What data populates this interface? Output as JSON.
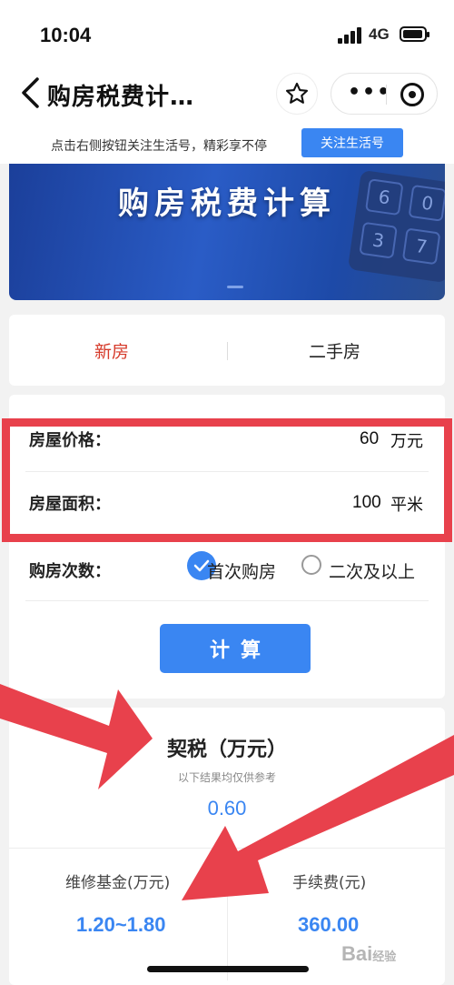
{
  "status": {
    "time": "10:04",
    "network": "4G"
  },
  "nav": {
    "title": "购房税费计…"
  },
  "follow": {
    "text": "点击右侧按钮关注生活号，精彩享不停",
    "button": "关注生活号"
  },
  "banner": {
    "title": "购房税费计算",
    "keys": [
      "6",
      "0",
      "3",
      "7"
    ]
  },
  "tabs": [
    {
      "label": "新房",
      "active": true
    },
    {
      "label": "二手房",
      "active": false
    }
  ],
  "form": {
    "price": {
      "label": "房屋价格：",
      "value": "60",
      "unit": "万元"
    },
    "area": {
      "label": "房屋面积：",
      "value": "100",
      "unit": "平米"
    },
    "times": {
      "label": "购房次数：",
      "options": [
        "首次购房",
        "二次及以上"
      ],
      "selected": "首次购房"
    },
    "calc_button": "计算"
  },
  "result": {
    "title": "契税（万元）",
    "note": "以下结果均仅供参考",
    "value": "0.60",
    "maintenance": {
      "label": "维修基金(万元)",
      "value": "1.20~1.80"
    },
    "fee": {
      "label": "手续费(元)",
      "value": "360.00"
    }
  },
  "watermark": {
    "text": "Bai",
    "sub": "经验"
  },
  "colors": {
    "accent": "#3a86f2",
    "active_tab": "#d63b2b",
    "annotation": "#e8414c"
  },
  "icons": [
    "back-icon",
    "star-icon",
    "more-icon",
    "target-icon",
    "check-icon",
    "signal-icon",
    "battery-icon"
  ]
}
